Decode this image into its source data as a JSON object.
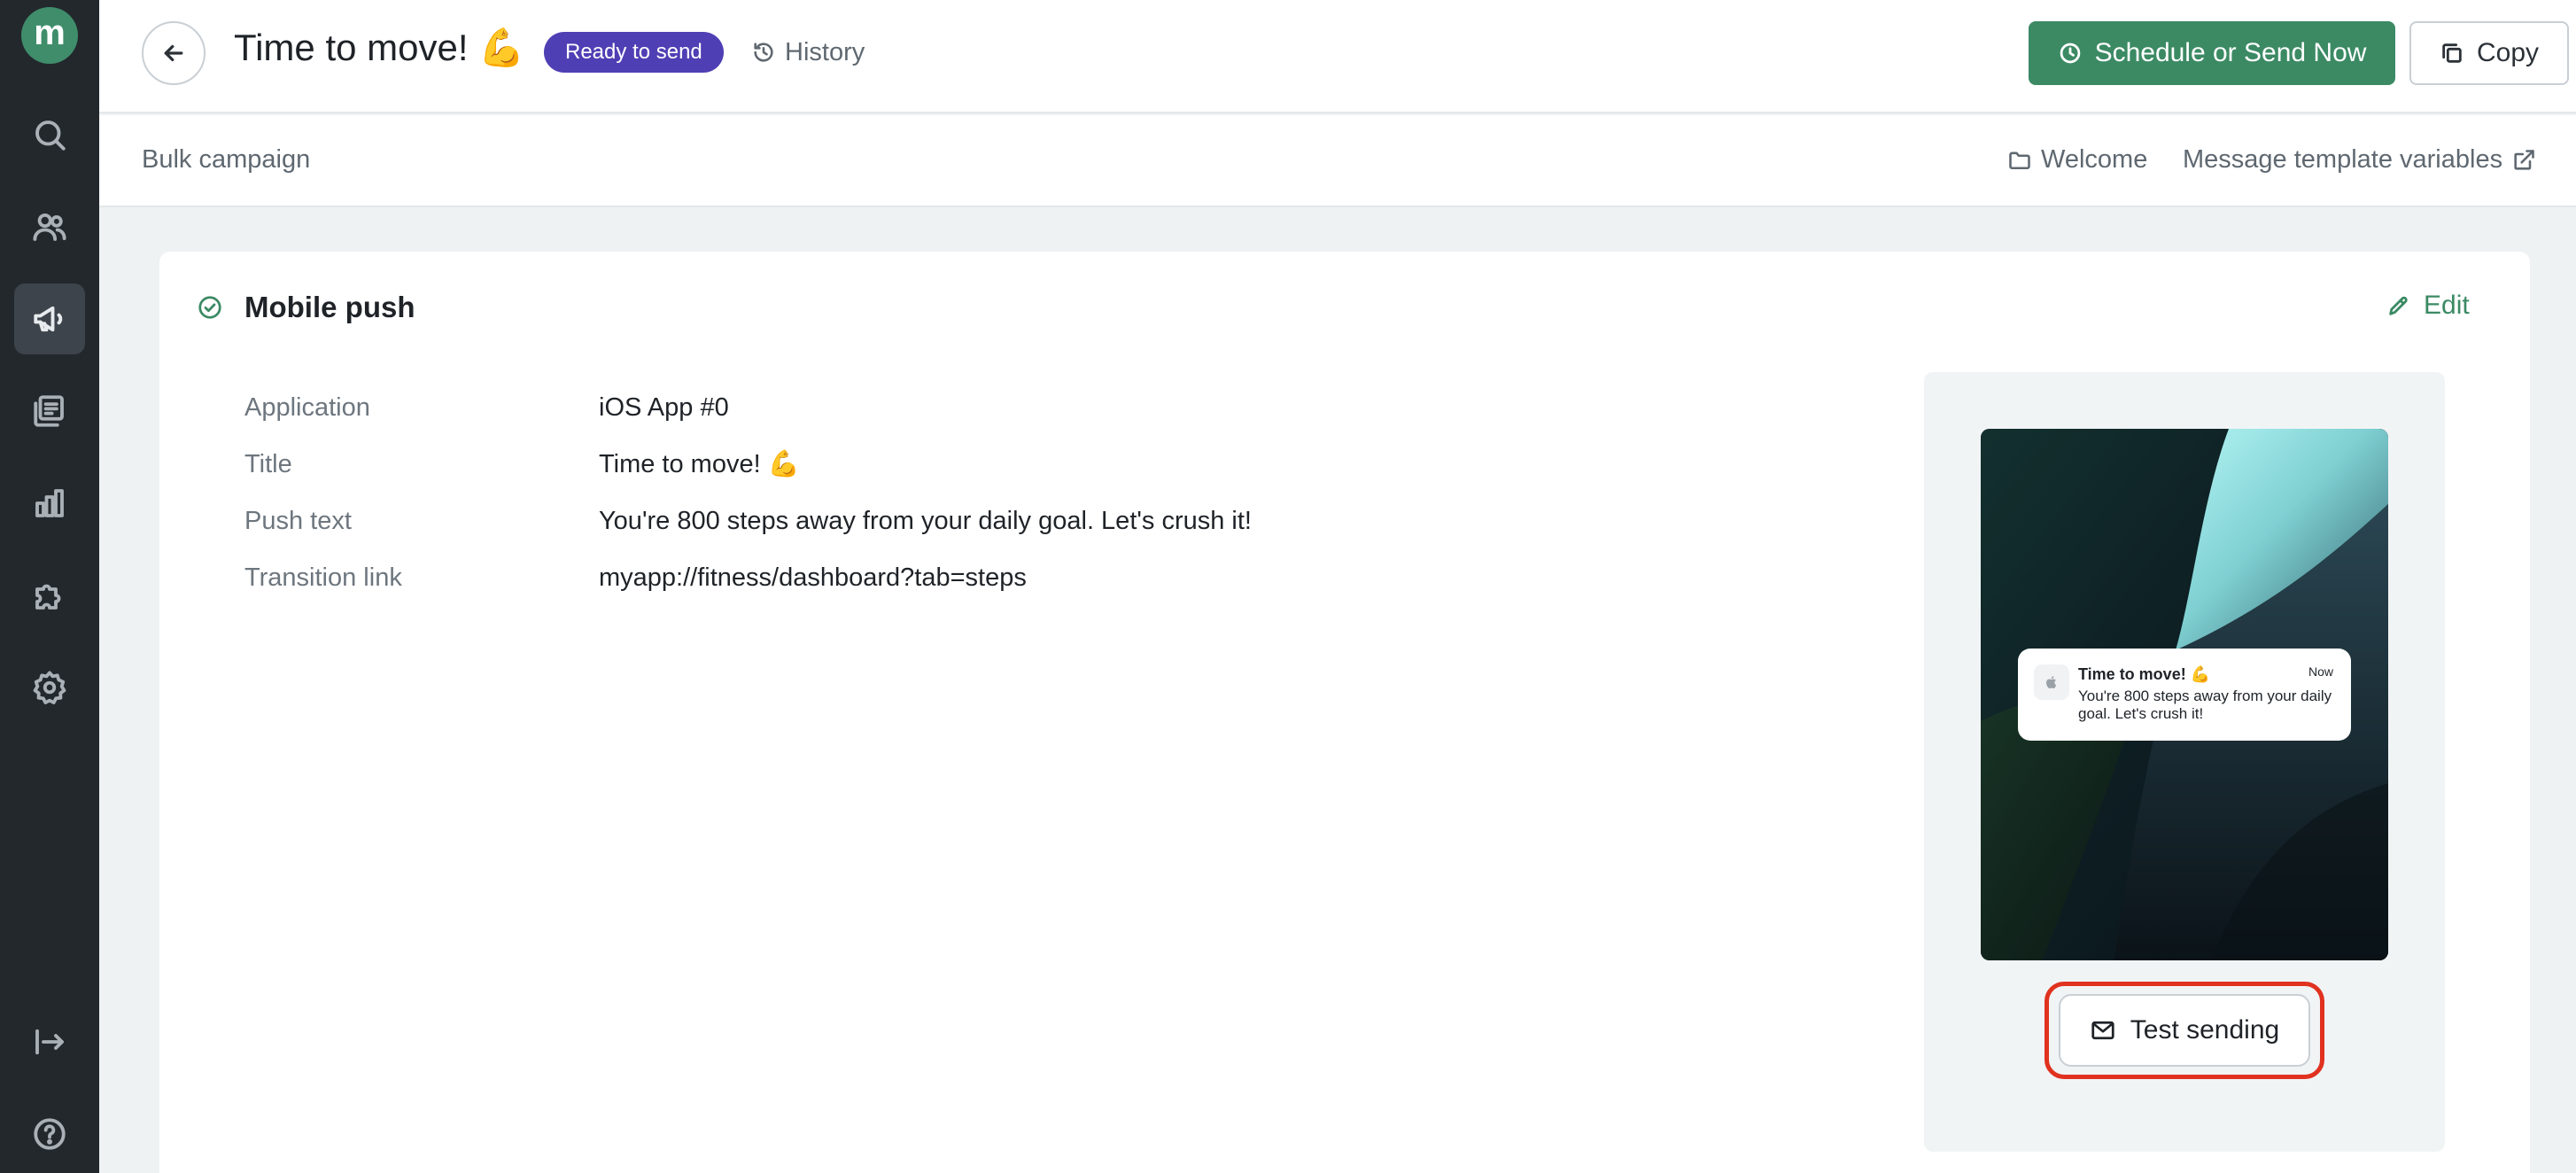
{
  "sidebar": {
    "logo_letter": "m",
    "items": [
      {
        "name": "search-icon"
      },
      {
        "name": "users-icon"
      },
      {
        "name": "megaphone-icon",
        "active": true
      },
      {
        "name": "messages-icon"
      },
      {
        "name": "analytics-icon"
      },
      {
        "name": "puzzle-icon"
      },
      {
        "name": "settings-icon"
      },
      {
        "name": "collapse-icon"
      },
      {
        "name": "help-icon"
      }
    ]
  },
  "header": {
    "title": "Time to move! 💪",
    "status": "Ready to send",
    "history_label": "History",
    "schedule_label": "Schedule or Send Now",
    "copy_label": "Copy"
  },
  "subheader": {
    "campaign_type": "Bulk campaign",
    "folder": "Welcome",
    "template_vars": "Message template variables"
  },
  "section": {
    "title": "Mobile push",
    "edit_label": "Edit",
    "fields": [
      {
        "label": "Application",
        "value": "iOS App #0"
      },
      {
        "label": "Title",
        "value": "Time to move! 💪"
      },
      {
        "label": "Push text",
        "value": "You're 800 steps away from your daily goal. Let's crush it!"
      },
      {
        "label": "Transition link",
        "value": "myapp://fitness/dashboard?tab=steps"
      }
    ]
  },
  "preview": {
    "notification": {
      "title": "Time to move! 💪",
      "time": "Now",
      "text": "You're 800 steps away from your daily goal. Let's crush it!"
    },
    "test_button_label": "Test sending"
  },
  "colors": {
    "accent_green": "#3b8a64",
    "badge_purple": "#4f3fb4",
    "highlight_red": "#e0321f",
    "sidebar_bg": "#23282d"
  }
}
